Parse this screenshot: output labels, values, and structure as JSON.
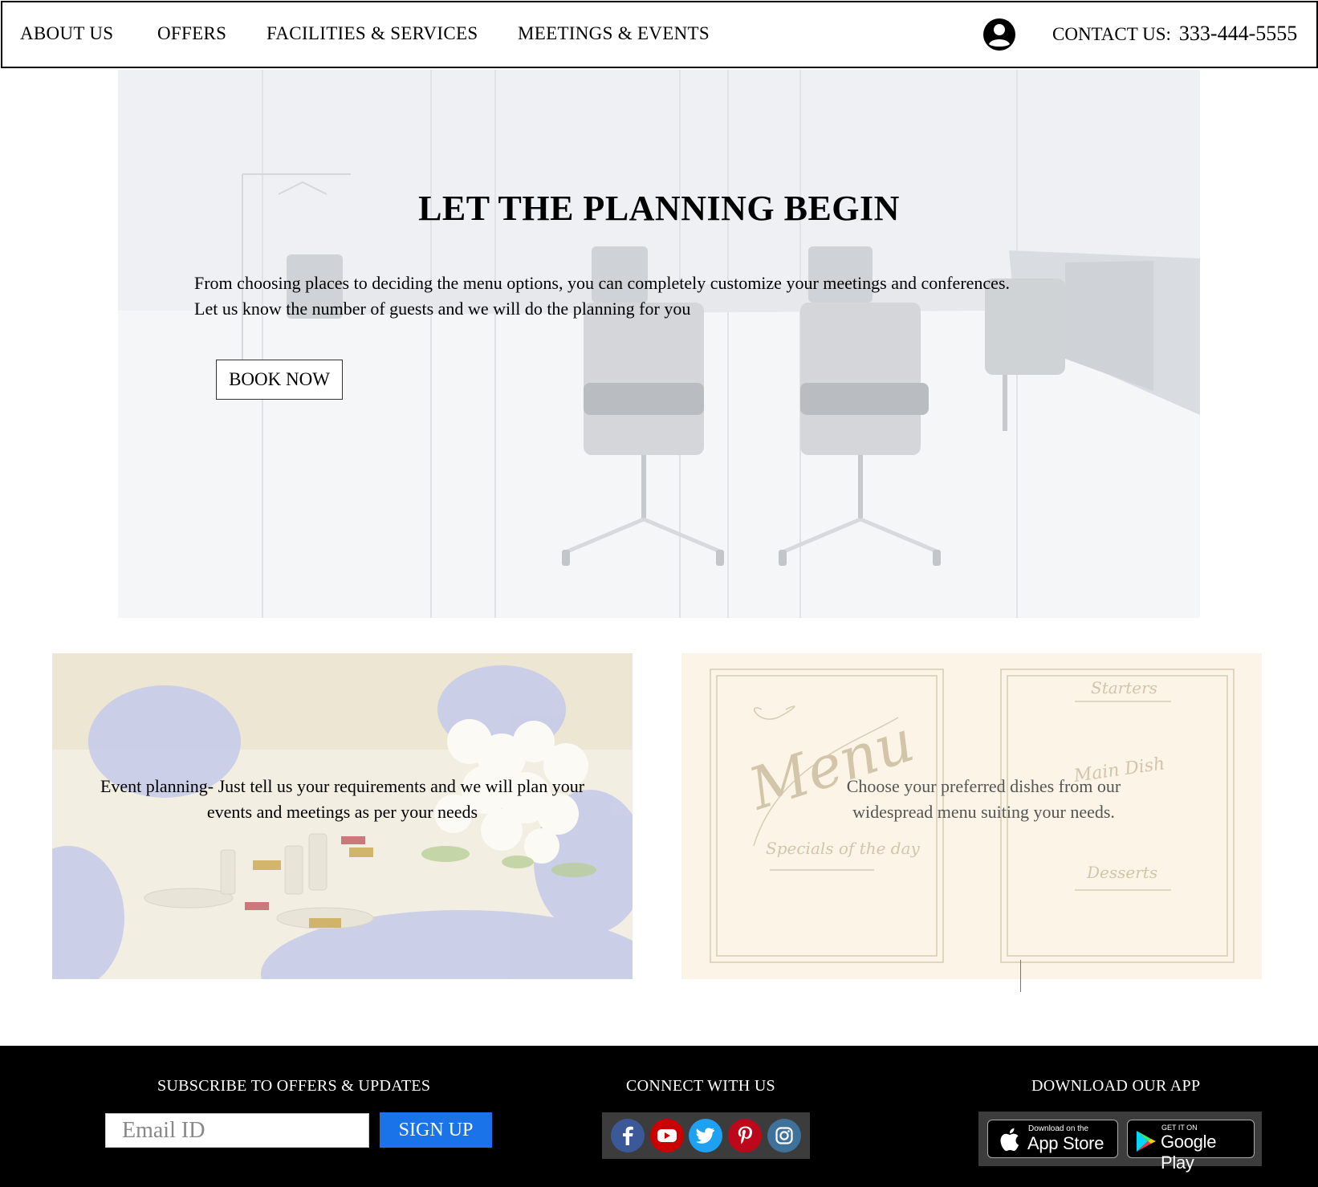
{
  "nav": {
    "items": [
      "ABOUT US",
      "OFFERS",
      "FACILITIES & SERVICES",
      "MEETINGS & EVENTS"
    ],
    "contact_label": "CONTACT US:",
    "contact_phone": "333-444-5555"
  },
  "hero": {
    "title": "LET THE PLANNING BEGIN",
    "text_line1": "From choosing places to deciding the menu options, you can completely customize your meetings and conferences.",
    "text_line2": "Let us know the number of guests and we will do the planning for you",
    "cta": "BOOK NOW"
  },
  "cards": {
    "event_text": "Event planning- Just tell us your requirements and we will plan your events and meetings as per your needs",
    "menu_text": "Choose your preferred dishes from our widespread menu suiting your needs.",
    "menu_image_labels": {
      "title": "Menu",
      "starters": "Starters",
      "main": "Main Dish",
      "specials": "Specials of the day",
      "desserts": "Desserts"
    }
  },
  "footer": {
    "subscribe_heading": "SUBSCRIBE TO OFFERS & UPDATES",
    "email_placeholder": "Email ID",
    "signup": "SIGN UP",
    "connect_heading": "CONNECT WITH US",
    "social": [
      {
        "name": "facebook",
        "color": "#3b5998"
      },
      {
        "name": "youtube",
        "color": "#cc0000"
      },
      {
        "name": "twitter",
        "color": "#1da1f2"
      },
      {
        "name": "pinterest",
        "color": "#bd081c"
      },
      {
        "name": "instagram",
        "color": "#3f729b"
      }
    ],
    "app_heading": "DOWNLOAD OUR APP",
    "app_store_small": "Download on the",
    "app_store_big": "App Store",
    "google_small": "GET IT ON",
    "google_big": "Google Play"
  },
  "colors": {
    "signup_bg": "#1a73e8",
    "footer_bg": "#000000",
    "menu_card_bg": "#fbf4e7"
  }
}
